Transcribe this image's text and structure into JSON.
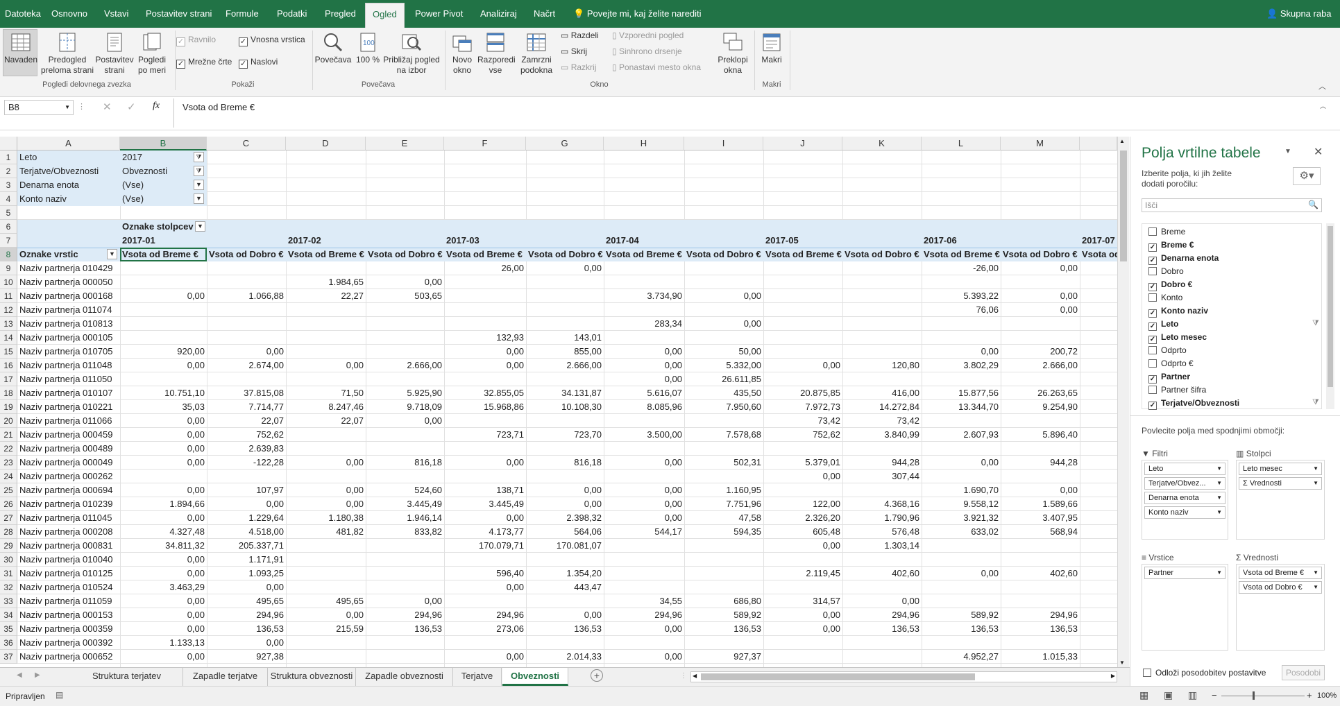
{
  "ribbon_tabs": [
    "Datoteka",
    "Osnovno",
    "Vstavi",
    "Postavitev strani",
    "Formule",
    "Podatki",
    "Pregled",
    "Ogled",
    "Power Pivot",
    "Analiziraj",
    "Načrt"
  ],
  "tell_me": "Povejte mi, kaj želite narediti",
  "share": "Skupna raba",
  "ribbon": {
    "views": {
      "normal": "Navaden",
      "page_break": "Predogled preloma strani",
      "page_layout": "Postavitev strani",
      "custom": "Pogledi po meri",
      "group": "Pogledi delovnega zvezka"
    },
    "show": {
      "ruler": "Ravnilo",
      "formula_bar": "Vnosna vrstica",
      "gridlines": "Mrežne črte",
      "headings": "Naslovi",
      "group": "Pokaži"
    },
    "zoom": {
      "zoom": "Povečava",
      "zoom100": "100 %",
      "zoom_sel": "Približaj pogled na izbor",
      "group": "Povečava"
    },
    "window": {
      "new": "Novo okno",
      "arrange": "Razporedi vse",
      "freeze": "Zamrzni podokna",
      "split": "Razdeli",
      "hide": "Skrij",
      "unhide": "Razkrij",
      "side": "Vzporedni pogled",
      "sync": "Sinhrono drsenje",
      "reset": "Ponastavi mesto okna",
      "switch": "Preklopi okna",
      "group": "Okno"
    },
    "macros": {
      "macros": "Makri",
      "group": "Makri"
    }
  },
  "formula_bar": {
    "name_box": "B8",
    "content": "Vsota od Breme €"
  },
  "columns": [
    "A",
    "B",
    "C",
    "D",
    "E",
    "F",
    "G",
    "H",
    "I",
    "J",
    "K",
    "L",
    "M"
  ],
  "filters": [
    {
      "label": "Leto",
      "value": "2017"
    },
    {
      "label": "Terjatve/Obveznosti",
      "value": "Obveznosti"
    },
    {
      "label": "Denarna enota",
      "value": "(Vse)"
    },
    {
      "label": "Konto naziv",
      "value": "(Vse)"
    }
  ],
  "pivot": {
    "column_labels": "Oznake stolpcev",
    "row_labels": "Oznake vrstic",
    "months": [
      "2017-01",
      "2017-02",
      "2017-03",
      "2017-04",
      "2017-05",
      "2017-06",
      "2017-07"
    ],
    "measure_debit": "Vsota od Breme €",
    "measure_credit": "Vsota od Dobro €",
    "measure_partial": "Vsota od"
  },
  "rows": [
    {
      "n": "9",
      "partner": "Naziv partnerja 010429",
      "v": [
        "",
        "",
        "",
        "",
        "26,00",
        "0,00",
        "",
        "",
        "",
        "",
        "-26,00",
        "0,00"
      ]
    },
    {
      "n": "10",
      "partner": "Naziv partnerja 000050",
      "v": [
        "",
        "",
        "1.984,65",
        "0,00",
        "",
        "",
        "",
        "",
        "",
        "",
        "",
        ""
      ]
    },
    {
      "n": "11",
      "partner": "Naziv partnerja 000168",
      "v": [
        "0,00",
        "1.066,88",
        "22,27",
        "503,65",
        "",
        "",
        "3.734,90",
        "0,00",
        "",
        "",
        "5.393,22",
        "0,00"
      ]
    },
    {
      "n": "12",
      "partner": "Naziv partnerja 011074",
      "v": [
        "",
        "",
        "",
        "",
        "",
        "",
        "",
        "",
        "",
        "",
        "76,06",
        "0,00"
      ]
    },
    {
      "n": "13",
      "partner": "Naziv partnerja 010813",
      "v": [
        "",
        "",
        "",
        "",
        "",
        "",
        "283,34",
        "0,00",
        "",
        "",
        "",
        ""
      ]
    },
    {
      "n": "14",
      "partner": "Naziv partnerja 000105",
      "v": [
        "",
        "",
        "",
        "",
        "132,93",
        "143,01",
        "",
        "",
        "",
        "",
        "",
        ""
      ]
    },
    {
      "n": "15",
      "partner": "Naziv partnerja 010705",
      "v": [
        "920,00",
        "0,00",
        "",
        "",
        "0,00",
        "855,00",
        "0,00",
        "50,00",
        "",
        "",
        "0,00",
        "200,72"
      ]
    },
    {
      "n": "16",
      "partner": "Naziv partnerja 011048",
      "v": [
        "0,00",
        "2.674,00",
        "0,00",
        "2.666,00",
        "0,00",
        "2.666,00",
        "0,00",
        "5.332,00",
        "0,00",
        "120,80",
        "3.802,29",
        "2.666,00"
      ]
    },
    {
      "n": "17",
      "partner": "Naziv partnerja 011050",
      "v": [
        "",
        "",
        "",
        "",
        "",
        "",
        "0,00",
        "26.611,85",
        "",
        "",
        "",
        ""
      ]
    },
    {
      "n": "18",
      "partner": "Naziv partnerja 010107",
      "v": [
        "10.751,10",
        "37.815,08",
        "71,50",
        "5.925,90",
        "32.855,05",
        "34.131,87",
        "5.616,07",
        "435,50",
        "20.875,85",
        "416,00",
        "15.877,56",
        "26.263,65"
      ]
    },
    {
      "n": "19",
      "partner": "Naziv partnerja 010221",
      "v": [
        "35,03",
        "7.714,77",
        "8.247,46",
        "9.718,09",
        "15.968,86",
        "10.108,30",
        "8.085,96",
        "7.950,60",
        "7.972,73",
        "14.272,84",
        "13.344,70",
        "9.254,90"
      ]
    },
    {
      "n": "20",
      "partner": "Naziv partnerja 011066",
      "v": [
        "0,00",
        "22,07",
        "22,07",
        "0,00",
        "",
        "",
        "",
        "",
        "73,42",
        "73,42",
        "",
        ""
      ]
    },
    {
      "n": "21",
      "partner": "Naziv partnerja 000459",
      "v": [
        "0,00",
        "752,62",
        "",
        "",
        "723,71",
        "723,70",
        "3.500,00",
        "7.578,68",
        "752,62",
        "3.840,99",
        "2.607,93",
        "5.896,40"
      ]
    },
    {
      "n": "22",
      "partner": "Naziv partnerja 000489",
      "v": [
        "0,00",
        "2.639,83",
        "",
        "",
        "",
        "",
        "",
        "",
        "",
        "",
        "",
        ""
      ]
    },
    {
      "n": "23",
      "partner": "Naziv partnerja 000049",
      "v": [
        "0,00",
        "-122,28",
        "0,00",
        "816,18",
        "0,00",
        "816,18",
        "0,00",
        "502,31",
        "5.379,01",
        "944,28",
        "0,00",
        "944,28"
      ]
    },
    {
      "n": "24",
      "partner": "Naziv partnerja 000262",
      "v": [
        "",
        "",
        "",
        "",
        "",
        "",
        "",
        "",
        "0,00",
        "307,44",
        "",
        ""
      ]
    },
    {
      "n": "25",
      "partner": "Naziv partnerja 000694",
      "v": [
        "0,00",
        "107,97",
        "0,00",
        "524,60",
        "138,71",
        "0,00",
        "0,00",
        "1.160,95",
        "",
        "",
        "1.690,70",
        "0,00"
      ]
    },
    {
      "n": "26",
      "partner": "Naziv partnerja 010239",
      "v": [
        "1.894,66",
        "0,00",
        "0,00",
        "3.445,49",
        "3.445,49",
        "0,00",
        "0,00",
        "7.751,96",
        "122,00",
        "4.368,16",
        "9.558,12",
        "1.589,66"
      ]
    },
    {
      "n": "27",
      "partner": "Naziv partnerja 011045",
      "v": [
        "0,00",
        "1.229,64",
        "1.180,38",
        "1.946,14",
        "0,00",
        "2.398,32",
        "0,00",
        "47,58",
        "2.326,20",
        "1.790,96",
        "3.921,32",
        "3.407,95"
      ]
    },
    {
      "n": "28",
      "partner": "Naziv partnerja 000208",
      "v": [
        "4.327,48",
        "4.518,00",
        "481,82",
        "833,82",
        "4.173,77",
        "564,06",
        "544,17",
        "594,35",
        "605,48",
        "576,48",
        "633,02",
        "568,94"
      ]
    },
    {
      "n": "29",
      "partner": "Naziv partnerja 000831",
      "v": [
        "34.811,32",
        "205.337,71",
        "",
        "",
        "170.079,71",
        "170.081,07",
        "",
        "",
        "0,00",
        "1.303,14",
        "",
        ""
      ]
    },
    {
      "n": "30",
      "partner": "Naziv partnerja 010040",
      "v": [
        "0,00",
        "1.171,91",
        "",
        "",
        "",
        "",
        "",
        "",
        "",
        "",
        "",
        ""
      ]
    },
    {
      "n": "31",
      "partner": "Naziv partnerja 010125",
      "v": [
        "0,00",
        "1.093,25",
        "",
        "",
        "596,40",
        "1.354,20",
        "",
        "",
        "2.119,45",
        "402,60",
        "0,00",
        "402,60"
      ]
    },
    {
      "n": "32",
      "partner": "Naziv partnerja 010524",
      "v": [
        "3.463,29",
        "0,00",
        "",
        "",
        "0,00",
        "443,47",
        "",
        "",
        "",
        "",
        "",
        ""
      ]
    },
    {
      "n": "33",
      "partner": "Naziv partnerja 011059",
      "v": [
        "0,00",
        "495,65",
        "495,65",
        "0,00",
        "",
        "",
        "34,55",
        "686,80",
        "314,57",
        "0,00",
        "",
        ""
      ]
    },
    {
      "n": "34",
      "partner": "Naziv partnerja 000153",
      "v": [
        "0,00",
        "294,96",
        "0,00",
        "294,96",
        "294,96",
        "0,00",
        "294,96",
        "589,92",
        "0,00",
        "294,96",
        "589,92",
        "294,96"
      ]
    },
    {
      "n": "35",
      "partner": "Naziv partnerja 000359",
      "v": [
        "0,00",
        "136,53",
        "215,59",
        "136,53",
        "273,06",
        "136,53",
        "0,00",
        "136,53",
        "0,00",
        "136,53",
        "136,53",
        "136,53"
      ]
    },
    {
      "n": "36",
      "partner": "Naziv partnerja 000392",
      "v": [
        "1.133,13",
        "0,00",
        "",
        "",
        "",
        "",
        "",
        "",
        "",
        "",
        "",
        ""
      ]
    },
    {
      "n": "37",
      "partner": "Naziv partnerja 000652",
      "v": [
        "0,00",
        "927,38",
        "",
        "",
        "0,00",
        "2.014,33",
        "0,00",
        "927,37",
        "",
        "",
        "4.952,27",
        "1.015,33"
      ]
    }
  ],
  "sheet_tabs": [
    "Struktura terjatev",
    "Zapadle terjatve",
    "Struktura obveznosti",
    "Zapadle obveznosti",
    "Terjatve",
    "Obveznosti"
  ],
  "status": {
    "ready": "Pripravljen",
    "zoom": "100%"
  },
  "pane": {
    "title": "Polja vrtilne tabele",
    "subtitle": "Izberite polja, ki jih želite dodati poročilu:",
    "search_placeholder": "Išči",
    "fields": [
      {
        "name": "Breme",
        "checked": false,
        "filter": false
      },
      {
        "name": "Breme €",
        "checked": true,
        "filter": false
      },
      {
        "name": "Denarna enota",
        "checked": true,
        "filter": false
      },
      {
        "name": "Dobro",
        "checked": false,
        "filter": false
      },
      {
        "name": "Dobro €",
        "checked": true,
        "filter": false
      },
      {
        "name": "Konto",
        "checked": false,
        "filter": false
      },
      {
        "name": "Konto naziv",
        "checked": true,
        "filter": false
      },
      {
        "name": "Leto",
        "checked": true,
        "filter": true
      },
      {
        "name": "Leto mesec",
        "checked": true,
        "filter": false
      },
      {
        "name": "Odprto",
        "checked": false,
        "filter": false
      },
      {
        "name": "Odprto €",
        "checked": false,
        "filter": false
      },
      {
        "name": "Partner",
        "checked": true,
        "filter": false
      },
      {
        "name": "Partner šifra",
        "checked": false,
        "filter": false
      },
      {
        "name": "Terjatve/Obveznosti",
        "checked": true,
        "filter": true
      }
    ],
    "drag_hint": "Povlecite polja med spodnjimi območji:",
    "areas": {
      "filters": {
        "label": "Filtri",
        "items": [
          "Leto",
          "Terjatve/Obvez...",
          "Denarna enota",
          "Konto naziv"
        ]
      },
      "columns": {
        "label": "Stolpci",
        "items": [
          "Leto mesec",
          "Σ  Vrednosti"
        ]
      },
      "rows": {
        "label": "Vrstice",
        "items": [
          "Partner"
        ]
      },
      "values": {
        "label": "Vrednosti",
        "items": [
          "Vsota od Breme €",
          "Vsota od Dobro €"
        ]
      }
    },
    "defer": "Odloži posodobitev postavitve",
    "update": "Posodobi"
  },
  "colors": {
    "accent": "#217346",
    "pivot_header": "#ddebf7"
  }
}
